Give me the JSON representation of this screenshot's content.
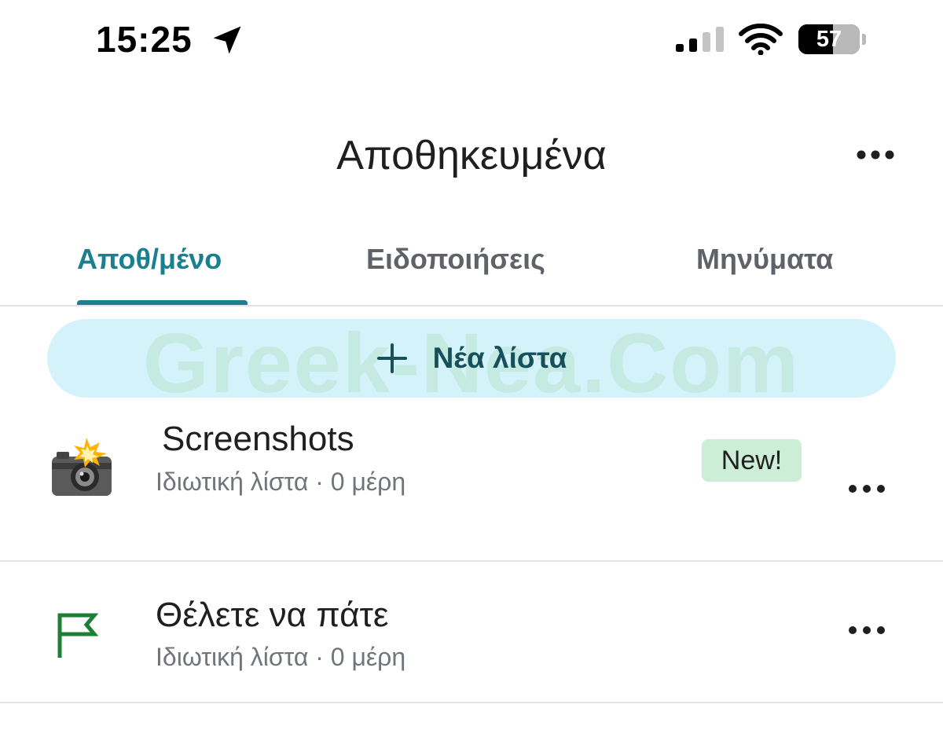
{
  "status_bar": {
    "time": "15:25",
    "battery_level": 57,
    "battery_text": "57",
    "location_icon": "location-arrow-icon",
    "signal_icon": "cellular-signal-icon",
    "wifi_icon": "wifi-icon"
  },
  "header": {
    "title": "Αποθηκευμένα",
    "more_icon": "more-horizontal-icon"
  },
  "tabs": [
    {
      "label": "Αποθ/μένο",
      "active": true
    },
    {
      "label": "Ειδοποιήσεις",
      "active": false
    },
    {
      "label": "Μηνύματα",
      "active": false
    }
  ],
  "new_list": {
    "label": "Νέα λίστα",
    "icon": "plus-icon",
    "watermark": "Greek-Nea.Com"
  },
  "lists": [
    {
      "title": "Screenshots",
      "subtitle": "Ιδιωτική λίστα · 0 μέρη",
      "badge": "New!",
      "icon": "camera-flash-icon"
    },
    {
      "title": "Θέλετε να πάτε",
      "subtitle": "Ιδιωτική λίστα · 0 μέρη",
      "icon": "flag-icon"
    }
  ],
  "colors": {
    "accent": "#1a7f8e",
    "new_list_bg": "#d4f2f9",
    "new_list_text": "#17505a",
    "badge_bg": "#cdeed6",
    "flag": "#1e7e34",
    "secondary_text": "#70757a"
  }
}
